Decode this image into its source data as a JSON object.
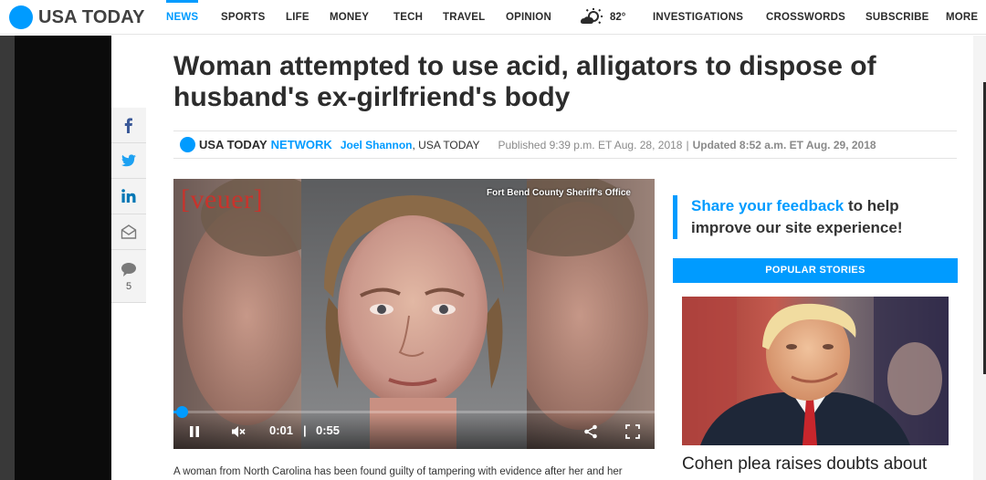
{
  "brand": {
    "name": "USA TODAY",
    "color": "#009bff"
  },
  "nav": {
    "items": [
      "NEWS",
      "SPORTS",
      "LIFE",
      "MONEY",
      "TECH",
      "TRAVEL",
      "OPINION"
    ],
    "active": "NEWS",
    "weather": "82°",
    "right_items": [
      "INVESTIGATIONS",
      "CROSSWORDS",
      "SUBSCRIBE",
      "MORE"
    ]
  },
  "share": {
    "icons": [
      "facebook-icon",
      "twitter-icon",
      "linkedin-icon",
      "email-icon",
      "comment-icon"
    ],
    "comment_count": "5"
  },
  "article": {
    "headline_line1": "Woman attempted to use acid, alligators to dispose of",
    "headline_line2": "husband's ex-girlfriend's body",
    "byline": {
      "brand": "USA TODAY",
      "network": "NETWORK",
      "author": "Joel Shannon",
      "org": ", USA TODAY",
      "published": "Published 9:39 p.m. ET Aug. 28, 2018",
      "separator": "|",
      "updated": "Updated 8:52 a.m. ET Aug. 29, 2018"
    },
    "video": {
      "watermark": "[veuer]",
      "credit": "Fort Bend County Sheriff's Office",
      "current_time": "0:01",
      "time_separator": "|",
      "duration": "0:55",
      "progress": 0.018
    },
    "first_line": "A woman from North Carolina has been found guilty of tampering with evidence after her and her"
  },
  "sidebar": {
    "feedback_link": "Share your feedback",
    "feedback_rest1": " to help",
    "feedback_line2": "improve our site experience!",
    "popular_header": "POPULAR STORIES",
    "popular_title": "Cohen plea raises doubts about"
  }
}
